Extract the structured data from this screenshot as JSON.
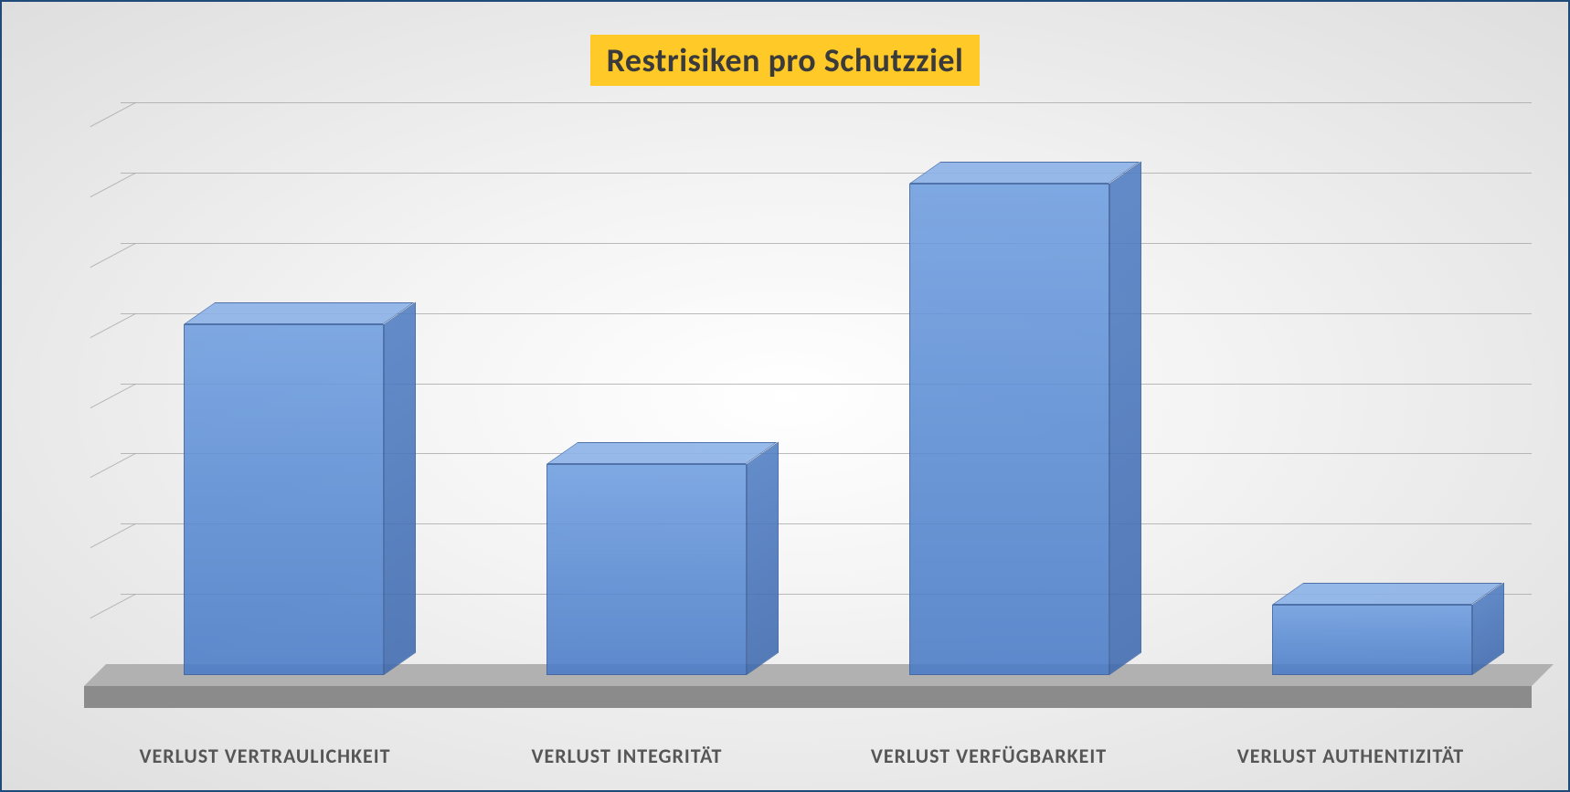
{
  "chart_data": {
    "type": "bar",
    "title": "Restrisiken pro Schutzziel",
    "categories": [
      "VERLUST VERTRAULICHKEIT",
      "VERLUST INTEGRITÄT",
      "VERLUST VERFÜGBARKEIT",
      "VERLUST AUTHENTIZITÄT"
    ],
    "values": [
      5,
      3,
      7,
      1
    ],
    "ylim": [
      0,
      8
    ],
    "gridlines": 8,
    "xlabel": "",
    "ylabel": "",
    "colors": {
      "bar_front": "#5a8cd4",
      "bar_side": "#3f6bb0",
      "bar_top": "#89b1e8",
      "title_bg": "#ffc928",
      "frame_border": "#1f4a7a"
    }
  }
}
